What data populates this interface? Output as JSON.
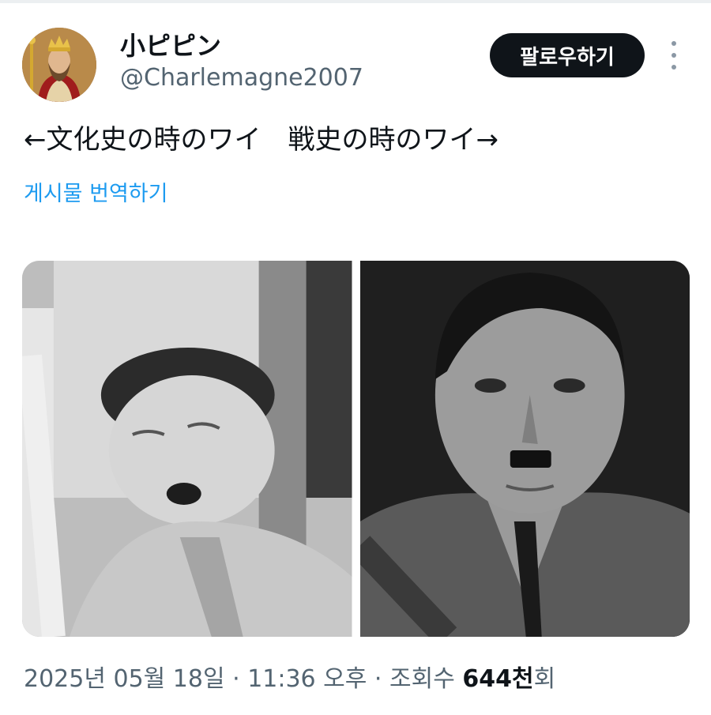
{
  "author": {
    "name": "小ピピン",
    "handle": "@Charlemagne2007"
  },
  "follow_button": "팔로우하기",
  "more_icon": "more-options-icon",
  "tweet": {
    "text": "←文化史の時のワイ　戦史の時のワイ→",
    "translate_link": "게시물 번역하기"
  },
  "footer": {
    "date": "2025년 05월 18일",
    "time": "11:36 오후",
    "views_label": "조회수",
    "views_count": "644천",
    "views_suffix": "회",
    "separator": " · "
  },
  "colors": {
    "link": "#1d9bf0",
    "muted": "#536471",
    "button_bg": "#0f1419"
  }
}
